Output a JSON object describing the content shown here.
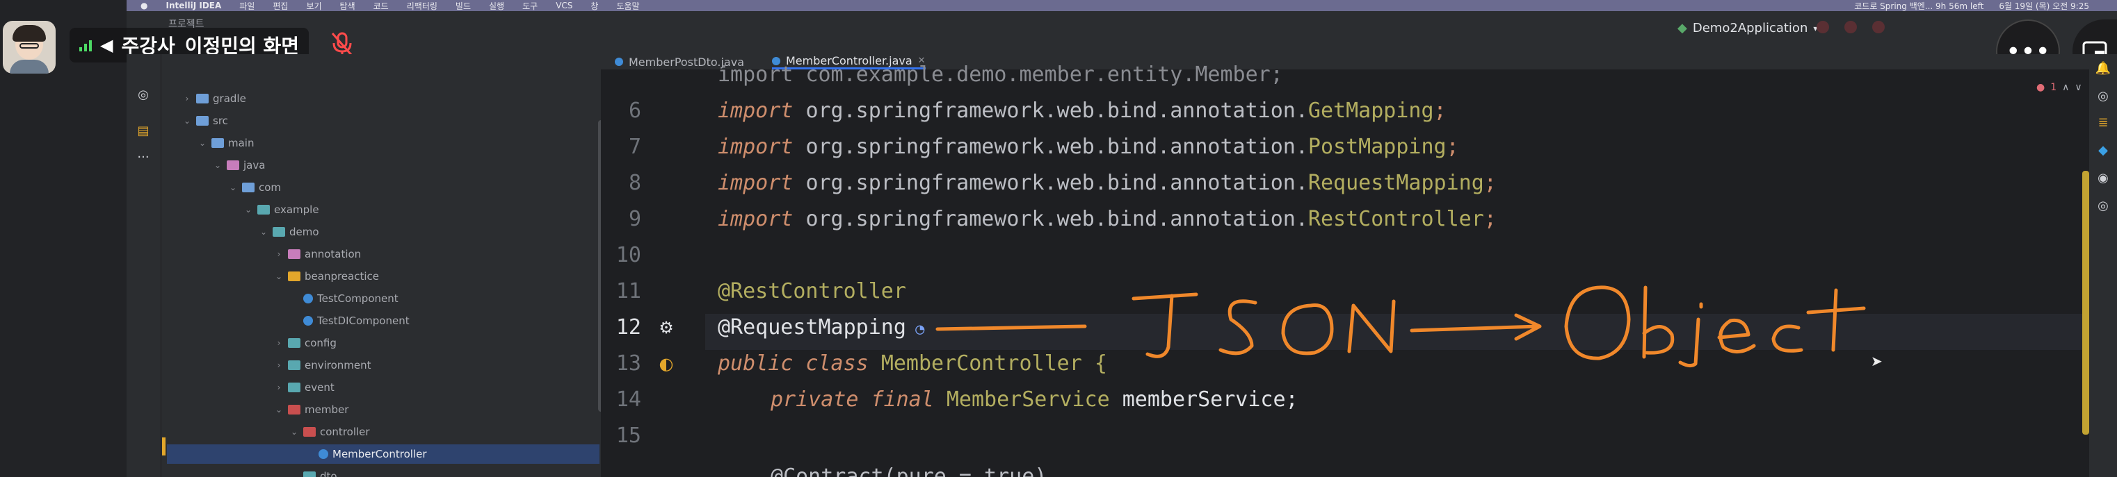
{
  "menubar": {
    "items": [
      "IntelliJ IDEA",
      "파일",
      "편집",
      "보기",
      "탐색",
      "코드",
      "리팩터링",
      "빌드",
      "실행",
      "도구",
      "VCS",
      "창",
      "도움말"
    ],
    "right": [
      "코드로 Spring 백엔... 9h 56m left",
      "6월 19일 (목) 오전 9:25"
    ]
  },
  "toolbar": {
    "project_label": "프로젝트",
    "run_config": "Demo2Application"
  },
  "presenter": {
    "name": "주강사_이정민의 화면"
  },
  "icons": {
    "more": "more-icon",
    "pip": "pip-icon",
    "mic_off": "mic-off-icon"
  },
  "tabs": [
    {
      "label": "MemberPostDto.java",
      "active": false
    },
    {
      "label": "MemberController.java",
      "active": true
    }
  ],
  "tree": [
    {
      "label": "gradle",
      "depth": 0,
      "expanded": false,
      "kind": "folder"
    },
    {
      "label": "src",
      "depth": 0,
      "expanded": true,
      "kind": "folder"
    },
    {
      "label": "main",
      "depth": 1,
      "expanded": true,
      "kind": "folder"
    },
    {
      "label": "java",
      "depth": 2,
      "expanded": true,
      "kind": "folder"
    },
    {
      "label": "com",
      "depth": 3,
      "expanded": true,
      "kind": "folder"
    },
    {
      "label": "example",
      "depth": 4,
      "expanded": true,
      "kind": "folder"
    },
    {
      "label": "demo",
      "depth": 5,
      "expanded": true,
      "kind": "folder"
    },
    {
      "label": "annotation",
      "depth": 6,
      "expanded": false,
      "kind": "folder"
    },
    {
      "label": "beanpreactice",
      "depth": 6,
      "expanded": true,
      "kind": "folder"
    },
    {
      "label": "TestComponent",
      "depth": 7,
      "expanded": false,
      "kind": "class"
    },
    {
      "label": "TestDIComponent",
      "depth": 7,
      "expanded": false,
      "kind": "class"
    },
    {
      "label": "config",
      "depth": 6,
      "expanded": false,
      "kind": "folder"
    },
    {
      "label": "environment",
      "depth": 6,
      "expanded": false,
      "kind": "folder"
    },
    {
      "label": "event",
      "depth": 6,
      "expanded": false,
      "kind": "folder"
    },
    {
      "label": "member",
      "depth": 6,
      "expanded": true,
      "kind": "folder"
    },
    {
      "label": "controller",
      "depth": 7,
      "expanded": true,
      "kind": "folder"
    },
    {
      "label": "MemberController",
      "depth": 8,
      "expanded": false,
      "kind": "class",
      "selected": true
    },
    {
      "label": "dto",
      "depth": 7,
      "expanded": true,
      "kind": "folder"
    }
  ],
  "code": {
    "line5": "import com.example.demo.member.entity.Member;",
    "line6_pkg": "org.springframework.web.bind.annotation.",
    "line6_cls": "GetMapping",
    "line7_cls": "PostMapping",
    "line8_cls": "RequestMapping",
    "line9_cls": "RestController",
    "import_kw": "import",
    "anno_rest": "@RestController",
    "anno_req": "@RequestMapping",
    "class_decl_kw": "public class",
    "class_name": "MemberController {",
    "field_kw": "private final",
    "field_type": "MemberService",
    "field_name": "memberService;",
    "contract": "@Contract(pure = true)",
    "line_numbers": [
      "6",
      "7",
      "8",
      "9",
      "10",
      "11",
      "12",
      "13",
      "14",
      "15"
    ]
  },
  "handwriting": {
    "text": "JSON → Object",
    "color": "#f0882b"
  },
  "inspection": {
    "count": "1"
  }
}
